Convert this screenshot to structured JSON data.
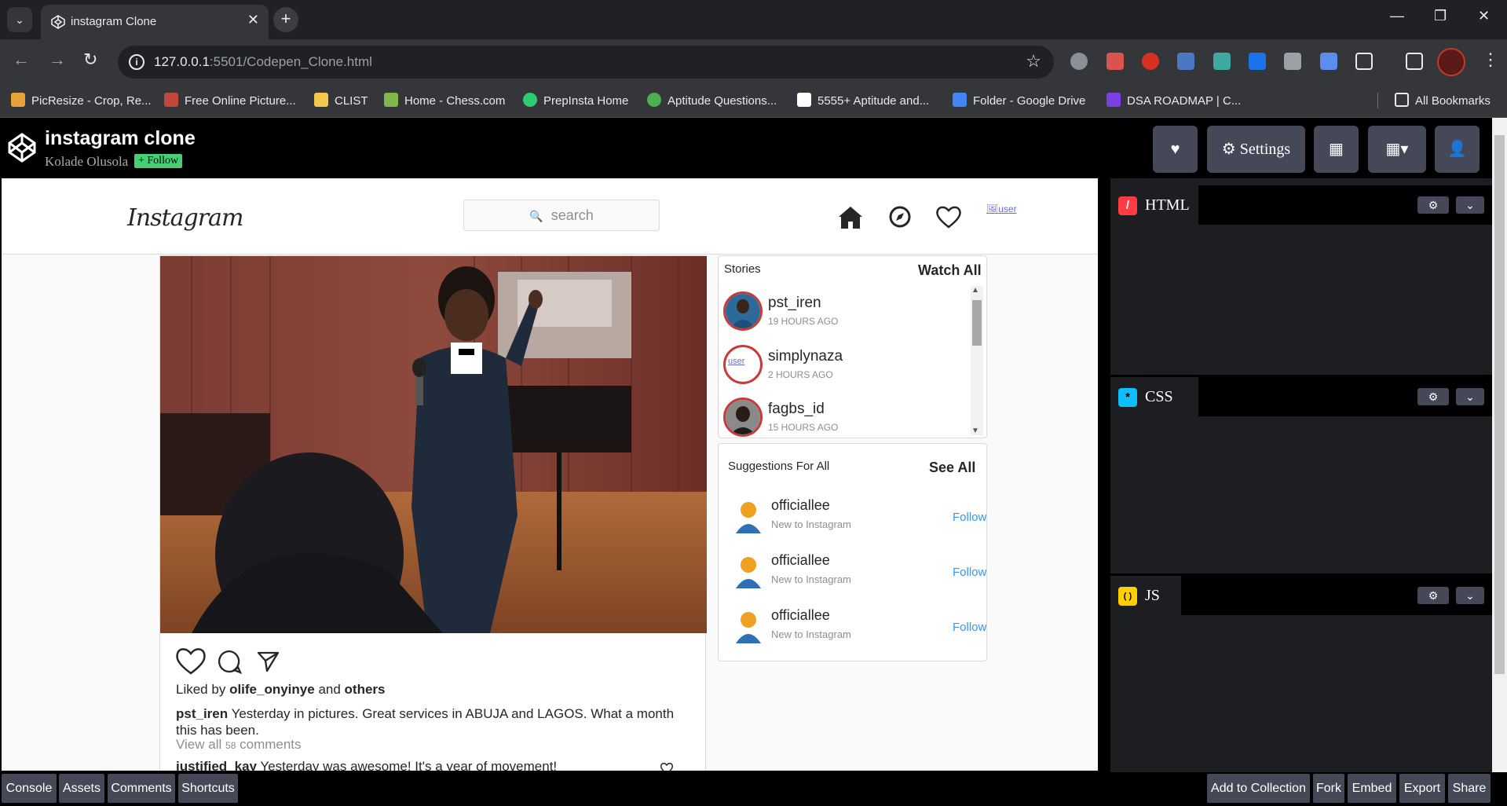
{
  "browser": {
    "tab_title": "instagram Clone",
    "url_host": "127.0.0.1",
    "url_rest": ":5501/Codepen_Clone.html",
    "bookmarks": [
      {
        "label": "PicResize - Crop, Re...",
        "color": "#e8a23a"
      },
      {
        "label": "Free Online Picture...",
        "color": "#c1483c"
      },
      {
        "label": "CLIST",
        "color": "#f2c94c"
      },
      {
        "label": "Home - Chess.com",
        "color": "#81b64c"
      },
      {
        "label": "PrepInsta Home",
        "color": "#2ecc71"
      },
      {
        "label": "Aptitude Questions...",
        "color": "#4caf50"
      },
      {
        "label": "5555+ Aptitude and...",
        "color": "#ffffff"
      },
      {
        "label": "Folder - Google Drive",
        "color": "#4285f4"
      },
      {
        "label": "DSA ROADMAP | C...",
        "color": "#7b3fe4"
      }
    ],
    "all_bookmarks": "All Bookmarks"
  },
  "codepen": {
    "title": "instagram clone",
    "author": "Kolade Olusola",
    "follow": "+ Follow",
    "settings": "Settings",
    "panels": [
      {
        "name": "HTML",
        "icon": "/",
        "icon_bg": "#ff3c41",
        "icon_color": "#fff"
      },
      {
        "name": "CSS",
        "icon": "*",
        "icon_bg": "#0ebeff",
        "icon_color": "#000"
      },
      {
        "name": "JS",
        "icon": "( )",
        "icon_bg": "#fcd000",
        "icon_color": "#000"
      }
    ],
    "footer_left": [
      "Console",
      "Assets",
      "Comments",
      "Shortcuts"
    ],
    "footer_right": [
      "Add to Collection",
      "Fork",
      "Embed",
      "Export",
      "Share"
    ]
  },
  "instagram": {
    "logo": "Instagram",
    "search_placeholder": "search",
    "avatar_alt": "user",
    "liked_by_prefix": "Liked by",
    "liked_by_user": "olife_onyinye",
    "liked_by_and": "and",
    "liked_by_others": "others",
    "caption_user": "pst_iren",
    "caption_text": "Yesterday in pictures. Great services in ABUJA and LAGOS. What a month this has been.",
    "view_all_prefix": "View all",
    "view_all_count": "58",
    "view_all_suffix": "comments",
    "comment_user": "justified_kay",
    "comment_text": "Yesterday was awesome! It's a year of movement!",
    "stories_title": "Stories",
    "watch_all": "Watch All",
    "stories": [
      {
        "name": "pst_iren",
        "time": "19 HOURS AGO"
      },
      {
        "name": "simplynaza",
        "time": "2 HOURS AGO",
        "alt": "user"
      },
      {
        "name": "fagbs_id",
        "time": "15 HOURS AGO"
      }
    ],
    "suggestions_title": "Suggestions For All",
    "see_all": "See All",
    "suggestions": [
      {
        "name": "officiallee",
        "sub": "New to Instagram",
        "action": "Follow"
      },
      {
        "name": "officiallee",
        "sub": "New to Instagram",
        "action": "Follow"
      },
      {
        "name": "officiallee",
        "sub": "New to Instagram",
        "action": "Follow"
      }
    ]
  }
}
